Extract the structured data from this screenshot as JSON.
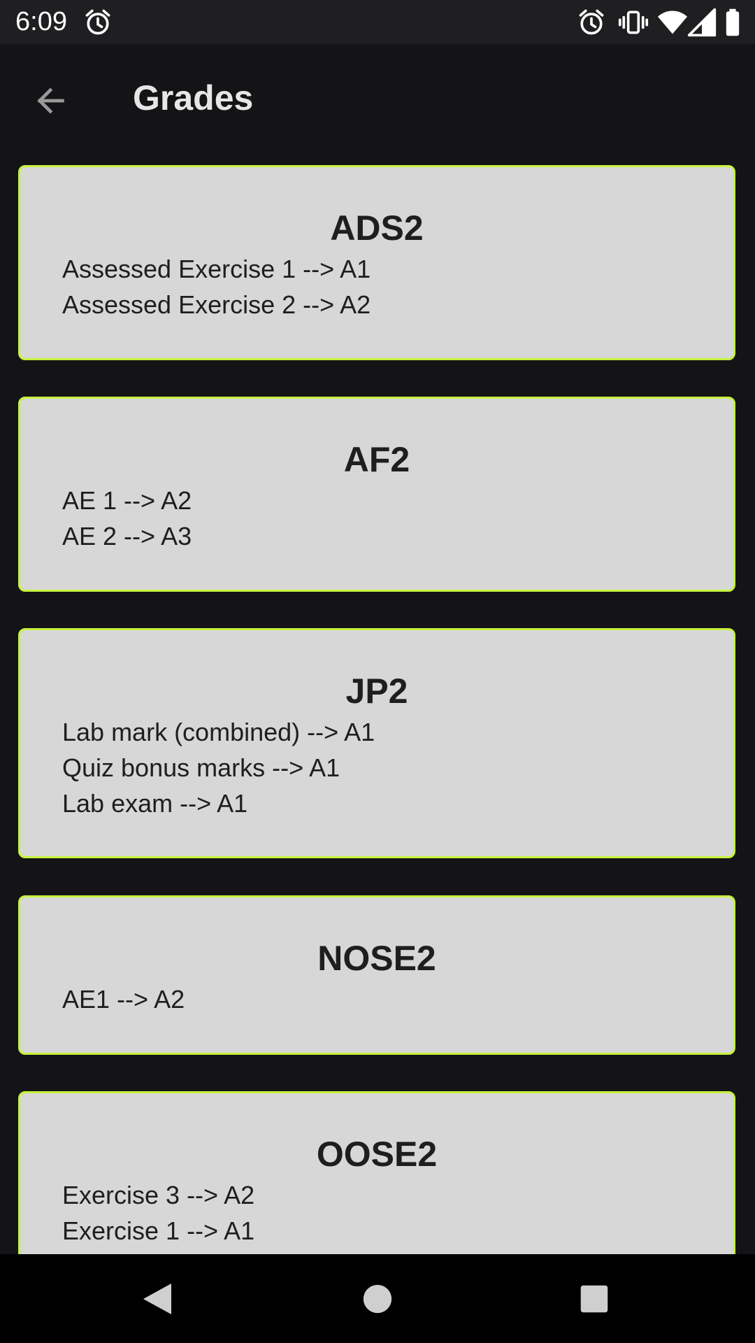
{
  "status_bar": {
    "time": "6:09",
    "icons": [
      "alarm-icon",
      "alarm-icon",
      "vibrate-icon",
      "wifi-icon",
      "signal-icon",
      "battery-icon"
    ]
  },
  "app_bar": {
    "title": "Grades",
    "back_icon": "arrow-back-icon"
  },
  "courses": [
    {
      "name": "ADS2",
      "grades": [
        "Assessed Exercise 1 -->  A1",
        "Assessed Exercise 2 -->  A2"
      ]
    },
    {
      "name": "AF2",
      "grades": [
        "AE 1 -->  A2",
        "AE 2 -->  A3"
      ]
    },
    {
      "name": "JP2",
      "grades": [
        "Lab mark (combined) -->  A1",
        "Quiz bonus marks -->  A1",
        "Lab exam -->  A1"
      ]
    },
    {
      "name": "NOSE2",
      "grades": [
        "AE1 -->  A2"
      ]
    },
    {
      "name": "OOSE2",
      "grades": [
        "Exercise 3 -->  A2",
        "Exercise 1 -->  A1"
      ]
    }
  ],
  "nav_bar": {
    "buttons": [
      "back-triangle-icon",
      "home-circle-icon",
      "recents-square-icon"
    ]
  },
  "colors": {
    "background": "#141416",
    "status_bar": "#1f1f21",
    "card_background": "#d7d7d7",
    "card_border": "#c6f23d",
    "card_text": "#1e1e1e",
    "title_text": "#e6e6e6"
  }
}
